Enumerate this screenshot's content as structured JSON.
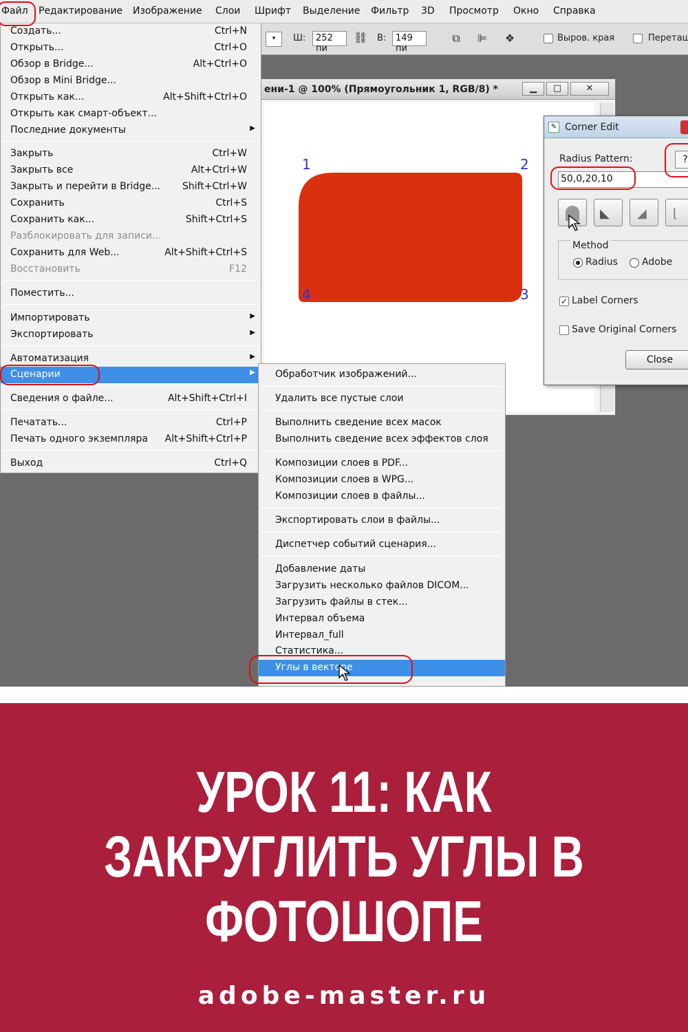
{
  "menubar": {
    "items": [
      "Файл",
      "Редактирование",
      "Изображение",
      "Слои",
      "Шрифт",
      "Выделение",
      "Фильтр",
      "3D",
      "Просмотр",
      "Окно",
      "Справка"
    ]
  },
  "options_bar": {
    "width_label": "Ш:",
    "width_value": "252 пи",
    "height_label": "В:",
    "height_value": "149 пи",
    "antialias_label": "Выров. края",
    "overlap_label": "Перетащ"
  },
  "document": {
    "title": "ени-1 @ 100% (Прямоугольник 1, RGB/8) *",
    "shape_color": "#d9300f",
    "corner_labels": [
      "1",
      "2",
      "3",
      "4"
    ]
  },
  "dialog": {
    "title": "Corner Edit",
    "radius_pattern_label": "Radius Pattern:",
    "help_label": "?",
    "radius_pattern_value": "50,0,20,10",
    "method_label": "Method",
    "method_options": [
      "Radius",
      "Adobe"
    ],
    "method_selected": "Radius",
    "label_corners": "Label Corners",
    "label_corners_checked": true,
    "save_original": "Save Original Corners",
    "save_original_checked": false,
    "close_label": "Close"
  },
  "file_menu": {
    "items": [
      {
        "label": "Создать...",
        "shortcut": "Ctrl+N"
      },
      {
        "label": "Открыть...",
        "shortcut": "Ctrl+O"
      },
      {
        "label": "Обзор в Bridge...",
        "shortcut": "Alt+Ctrl+O"
      },
      {
        "label": "Обзор в Mini Bridge...",
        "shortcut": ""
      },
      {
        "label": "Открыть как...",
        "shortcut": "Alt+Shift+Ctrl+O"
      },
      {
        "label": "Открыть как смарт-объект...",
        "shortcut": ""
      },
      {
        "label": "Последние документы",
        "shortcut": ""
      },
      {
        "label": "Закрыть",
        "shortcut": "Ctrl+W"
      },
      {
        "label": "Закрыть все",
        "shortcut": "Alt+Ctrl+W"
      },
      {
        "label": "Закрыть и перейти в Bridge...",
        "shortcut": "Shift+Ctrl+W"
      },
      {
        "label": "Сохранить",
        "shortcut": "Ctrl+S"
      },
      {
        "label": "Сохранить как...",
        "shortcut": "Shift+Ctrl+S"
      },
      {
        "label": "Разблокировать для записи...",
        "shortcut": ""
      },
      {
        "label": "Сохранить для Web...",
        "shortcut": "Alt+Shift+Ctrl+S"
      },
      {
        "label": "Восстановить",
        "shortcut": "F12"
      },
      {
        "label": "Поместить...",
        "shortcut": ""
      },
      {
        "label": "Импортировать",
        "shortcut": ""
      },
      {
        "label": "Экспортировать",
        "shortcut": ""
      },
      {
        "label": "Автоматизация",
        "shortcut": ""
      },
      {
        "label": "Сценарии",
        "shortcut": ""
      },
      {
        "label": "Сведения о файле...",
        "shortcut": "Alt+Shift+Ctrl+I"
      },
      {
        "label": "Печатать...",
        "shortcut": "Ctrl+P"
      },
      {
        "label": "Печать одного экземпляра",
        "shortcut": "Alt+Shift+Ctrl+P"
      },
      {
        "label": "Выход",
        "shortcut": "Ctrl+Q"
      }
    ]
  },
  "scripts_menu": {
    "items": [
      "Обработчик изображений...",
      "Удалить все пустые слои",
      "Выполнить сведение всех масок",
      "Выполнить сведение всех эффектов слоя",
      "Композиции слоев в PDF...",
      "Композиции слоев в WPG...",
      "Композиции слоев в файлы...",
      "Экспортировать слои в файлы...",
      "Диспетчер событий сценария...",
      "Добавление даты",
      "Загрузить несколько файлов DICOM...",
      "Загрузить файлы в стек...",
      "Интервал объема",
      "Интервал_full",
      "Статистика...",
      "Углы в векторе"
    ]
  },
  "banner": {
    "title_line1": "УРОК 11: КАК",
    "title_line2": "ЗАКРУГЛИТЬ УГЛЫ В",
    "title_line3": "ФОТОШОПЕ",
    "site": "adobe-master.ru",
    "color": "#aa1f3b"
  }
}
